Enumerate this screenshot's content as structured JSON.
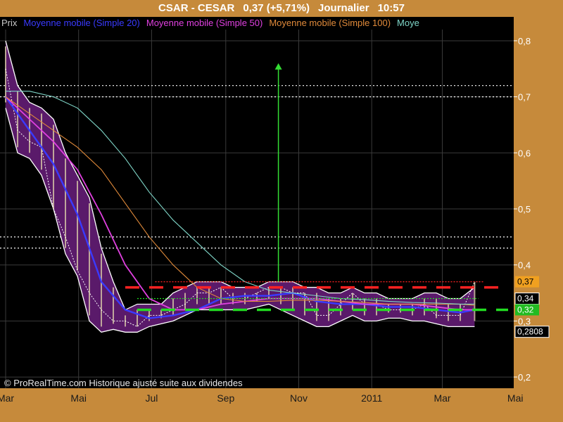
{
  "header": {
    "instrument": "CSAR - CESAR",
    "quote": "0,37 (+5,71%)",
    "period": "Journalier",
    "time": "10:57"
  },
  "legend": {
    "items": [
      {
        "label": "Prix",
        "color": "#c8c8c8"
      },
      {
        "label": "Moyenne mobile (Simple 20)",
        "color": "#3a3aff"
      },
      {
        "label": "Moyenne mobile (Simple 50)",
        "color": "#e040e0"
      },
      {
        "label": "Moyenne mobile (Simple 100)",
        "color": "#e08a3a"
      },
      {
        "label": "Moye",
        "color": "#7fd6c8"
      }
    ]
  },
  "footer_note": "© ProRealTime.com Historique ajusté suite aux dividendes",
  "colors": {
    "plot_bg": "#000000",
    "frame_bg": "#c68a3b",
    "sma20": "#3a3aff",
    "sma50": "#e040e0",
    "sma100": "#e08a3a",
    "sma200": "#7fd6c8",
    "band_fill": "#5a1a6a",
    "candle": "#d9c9a8",
    "arrow": "#33dd33",
    "resistance_red": "#ff2222",
    "support_green": "#22dd22"
  },
  "price_boxes": [
    {
      "label": "0,37",
      "value": 0.37,
      "bg": "#f0a020",
      "fg": "#000000"
    },
    {
      "label": "0,34",
      "value": 0.34,
      "bg": "#000000",
      "fg": "#ffffff"
    },
    {
      "label": "0,32",
      "value": 0.32,
      "bg": "#22bb22",
      "fg": "#ffffff"
    },
    {
      "label": "0,2808",
      "value": 0.2808,
      "bg": "#000000",
      "fg": "#ffffff"
    }
  ],
  "chart_data": {
    "type": "line",
    "title": "CSAR - CESAR",
    "xlabel": "",
    "ylabel": "",
    "ylim": [
      0.18,
      0.82
    ],
    "y_ticks": [
      {
        "value": 0.2,
        "label": "0,2",
        "bold": false
      },
      {
        "value": 0.3,
        "label": "0,3",
        "bold": false
      },
      {
        "value": 0.4,
        "label": "0,4",
        "bold": false
      },
      {
        "value": 0.5,
        "label": "0,5",
        "bold": true
      },
      {
        "value": 0.6,
        "label": "0,6",
        "bold": false
      },
      {
        "value": 0.7,
        "label": "0,7",
        "bold": false
      },
      {
        "value": 0.8,
        "label": "0,8",
        "bold": false
      }
    ],
    "x_range": [
      0,
      420
    ],
    "x_ticks": [
      {
        "x": 0,
        "label": "Mar",
        "bold": false
      },
      {
        "x": 61,
        "label": "Mai",
        "bold": false
      },
      {
        "x": 122,
        "label": "Jul",
        "bold": false
      },
      {
        "x": 184,
        "label": "Sep",
        "bold": false
      },
      {
        "x": 245,
        "label": "Nov",
        "bold": false
      },
      {
        "x": 306,
        "label": "2011",
        "bold": true
      },
      {
        "x": 365,
        "label": "Mar",
        "bold": false
      },
      {
        "x": 426,
        "label": "Mai",
        "bold": false
      }
    ],
    "grid": true,
    "legend_position": "top-left",
    "price_x": [
      0,
      10,
      20,
      30,
      40,
      50,
      60,
      70,
      80,
      90,
      100,
      110,
      120,
      130,
      140,
      150,
      160,
      170,
      180,
      190,
      200,
      210,
      220,
      230,
      240,
      250,
      260,
      270,
      280,
      290,
      300,
      310,
      320,
      330,
      340,
      350,
      360,
      370,
      380,
      392
    ],
    "price_close": [
      0.75,
      0.64,
      0.62,
      0.61,
      0.5,
      0.45,
      0.39,
      0.35,
      0.32,
      0.3,
      0.3,
      0.29,
      0.31,
      0.31,
      0.32,
      0.33,
      0.35,
      0.35,
      0.36,
      0.34,
      0.34,
      0.35,
      0.36,
      0.36,
      0.35,
      0.35,
      0.31,
      0.31,
      0.33,
      0.35,
      0.33,
      0.33,
      0.32,
      0.32,
      0.32,
      0.33,
      0.31,
      0.31,
      0.31,
      0.37
    ],
    "series": [
      {
        "name": "Moyenne mobile (Simple 20)",
        "color": "#3a3aff",
        "x": [
          0,
          20,
          40,
          60,
          80,
          100,
          120,
          140,
          160,
          180,
          200,
          220,
          240,
          260,
          280,
          300,
          320,
          340,
          360,
          380,
          392
        ],
        "values": [
          0.7,
          0.64,
          0.58,
          0.49,
          0.37,
          0.32,
          0.305,
          0.31,
          0.32,
          0.34,
          0.345,
          0.345,
          0.35,
          0.335,
          0.33,
          0.33,
          0.325,
          0.325,
          0.32,
          0.315,
          0.32
        ]
      },
      {
        "name": "Moyenne mobile (Simple 50)",
        "color": "#e040e0",
        "x": [
          0,
          20,
          40,
          60,
          80,
          100,
          120,
          140,
          160,
          180,
          200,
          220,
          240,
          260,
          280,
          300,
          320,
          340,
          360,
          380,
          392
        ],
        "values": [
          0.7,
          0.66,
          0.62,
          0.57,
          0.49,
          0.4,
          0.34,
          0.32,
          0.32,
          0.33,
          0.335,
          0.34,
          0.34,
          0.34,
          0.335,
          0.33,
          0.33,
          0.33,
          0.325,
          0.32,
          0.32
        ]
      },
      {
        "name": "Moyenne mobile (Simple 100)",
        "color": "#e08a3a",
        "x": [
          0,
          20,
          40,
          60,
          80,
          100,
          120,
          140,
          160,
          180,
          200,
          220,
          240,
          260,
          280,
          300,
          320,
          340,
          360,
          380,
          392
        ],
        "values": [
          0.7,
          0.67,
          0.64,
          0.61,
          0.57,
          0.51,
          0.45,
          0.4,
          0.36,
          0.34,
          0.335,
          0.335,
          0.337,
          0.337,
          0.335,
          0.333,
          0.33,
          0.33,
          0.33,
          0.33,
          0.328
        ]
      },
      {
        "name": "Moye",
        "color": "#7fd6c8",
        "x": [
          0,
          20,
          40,
          60,
          80,
          100,
          120,
          140,
          160,
          180,
          200,
          220,
          240,
          260,
          280,
          300,
          320,
          340,
          360,
          380,
          392
        ],
        "values": [
          0.71,
          0.71,
          0.7,
          0.68,
          0.64,
          0.59,
          0.53,
          0.48,
          0.44,
          0.4,
          0.37,
          0.355,
          0.35,
          0.345,
          0.34,
          0.338,
          0.335,
          0.333,
          0.332,
          0.33,
          0.33
        ]
      }
    ],
    "bands": {
      "x": [
        0,
        10,
        20,
        30,
        40,
        50,
        60,
        70,
        80,
        90,
        100,
        110,
        120,
        130,
        140,
        150,
        160,
        170,
        180,
        190,
        200,
        210,
        220,
        230,
        240,
        250,
        260,
        270,
        280,
        290,
        300,
        310,
        320,
        330,
        340,
        350,
        360,
        370,
        380,
        392
      ],
      "upper": [
        0.8,
        0.72,
        0.69,
        0.68,
        0.66,
        0.6,
        0.56,
        0.52,
        0.43,
        0.37,
        0.32,
        0.33,
        0.33,
        0.33,
        0.35,
        0.36,
        0.37,
        0.37,
        0.37,
        0.36,
        0.36,
        0.36,
        0.37,
        0.37,
        0.37,
        0.36,
        0.36,
        0.35,
        0.35,
        0.36,
        0.35,
        0.35,
        0.34,
        0.34,
        0.34,
        0.35,
        0.35,
        0.34,
        0.34,
        0.36
      ],
      "lower": [
        0.68,
        0.6,
        0.59,
        0.56,
        0.5,
        0.42,
        0.38,
        0.3,
        0.28,
        0.285,
        0.28,
        0.28,
        0.29,
        0.295,
        0.3,
        0.31,
        0.32,
        0.32,
        0.32,
        0.32,
        0.32,
        0.325,
        0.33,
        0.32,
        0.31,
        0.3,
        0.29,
        0.29,
        0.3,
        0.31,
        0.3,
        0.3,
        0.305,
        0.305,
        0.3,
        0.3,
        0.295,
        0.29,
        0.29,
        0.29
      ]
    },
    "annotations": {
      "horizontal_dotted_white": [
        0.72,
        0.7,
        0.45,
        0.43
      ],
      "resistance_dashed_red": {
        "value": 0.36,
        "x_start": 100,
        "x_end": 420
      },
      "resistance_dotted_red": {
        "value": 0.37,
        "x_start": 125,
        "x_end": 400
      },
      "support_dashed_green": {
        "value": 0.32,
        "x_start": 110,
        "x_end": 420
      },
      "support_dotted_green": {
        "value": 0.34,
        "x_start": 110,
        "x_end": 395
      },
      "target_arrow": {
        "x": 228,
        "from": 0.37,
        "to": 0.76
      }
    }
  }
}
